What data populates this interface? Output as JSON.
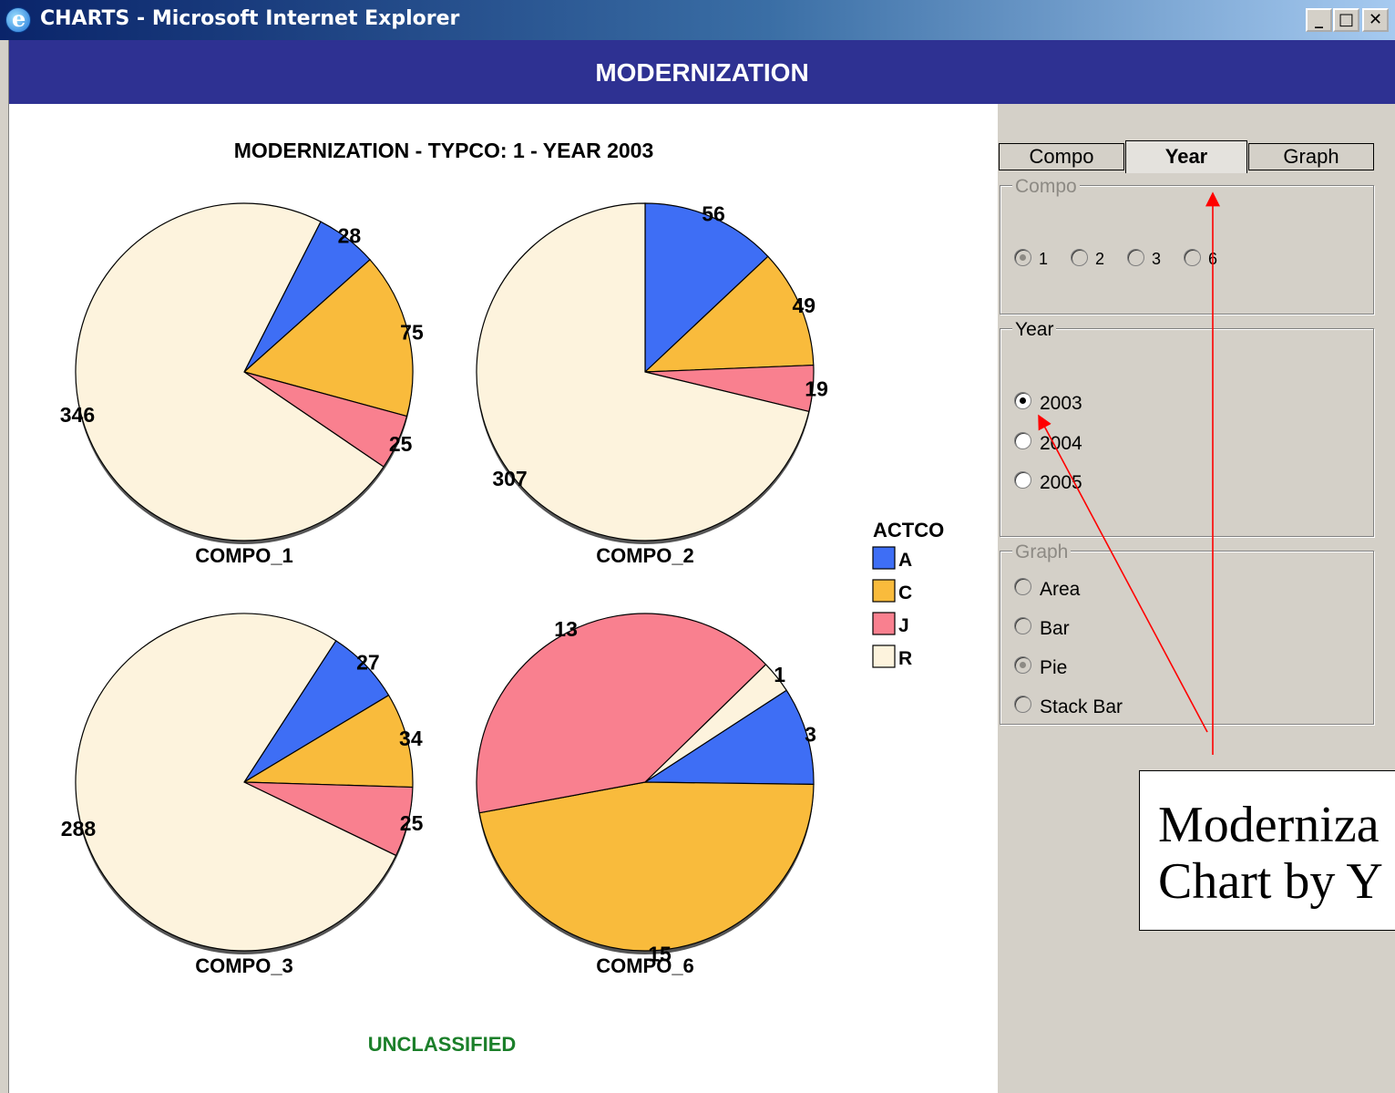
{
  "window": {
    "title": "CHARTS - Microsoft Internet Explorer",
    "icon": "ie-icon",
    "controls": {
      "minimize": "_",
      "maximize": "□",
      "close": "✕"
    }
  },
  "header": {
    "title": "MODERNIZATION"
  },
  "chart_title": "MODERNIZATION - TYPCO: 1  - YEAR 2003",
  "footer_label": "UNCLASSIFIED",
  "legend": {
    "title": "ACTCO",
    "items": [
      {
        "label": "A",
        "color": "#3e6ef5"
      },
      {
        "label": "C",
        "color": "#f9bb3c"
      },
      {
        "label": "J",
        "color": "#f9808f"
      },
      {
        "label": "R",
        "color": "#fdf3dd"
      }
    ]
  },
  "chart_data": {
    "type": "pie",
    "categories": [
      "A",
      "C",
      "J",
      "R"
    ],
    "pies": [
      {
        "name": "COMPO_1",
        "values": [
          28,
          75,
          25,
          346
        ]
      },
      {
        "name": "COMPO_2",
        "values": [
          56,
          49,
          19,
          307
        ]
      },
      {
        "name": "COMPO_3",
        "values": [
          27,
          34,
          25,
          288
        ]
      },
      {
        "name": "COMPO_6",
        "values": [
          3,
          15,
          13,
          1
        ]
      }
    ]
  },
  "tabs": [
    {
      "label": "Compo",
      "selected": false
    },
    {
      "label": "Year",
      "selected": true
    },
    {
      "label": "Graph",
      "selected": false
    }
  ],
  "compo_group": {
    "label": "Compo",
    "options": [
      {
        "label": "1",
        "selected": true
      },
      {
        "label": "2",
        "selected": false
      },
      {
        "label": "3",
        "selected": false
      },
      {
        "label": "6",
        "selected": false
      }
    ]
  },
  "year_group": {
    "label": "Year",
    "options": [
      {
        "label": "2003",
        "selected": true
      },
      {
        "label": "2004",
        "selected": false
      },
      {
        "label": "2005",
        "selected": false
      }
    ]
  },
  "graph_group": {
    "label": "Graph",
    "options": [
      {
        "label": "Area",
        "selected": false
      },
      {
        "label": "Bar",
        "selected": false
      },
      {
        "label": "Pie",
        "selected": true
      },
      {
        "label": "Stack Bar",
        "selected": false
      }
    ]
  },
  "note": {
    "line1": "Moderniza",
    "line2": "Chart by Y"
  },
  "annotation_color": "#ff0000"
}
